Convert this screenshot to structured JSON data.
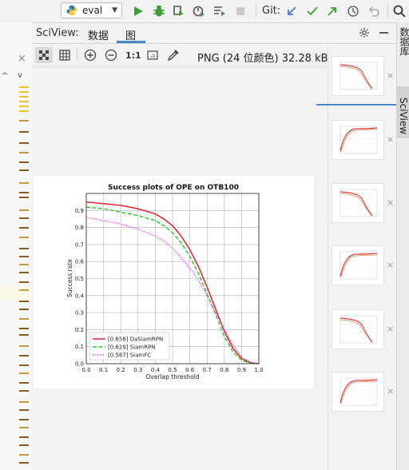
{
  "toolbar": {
    "run_config": "eval",
    "git_label": "Git:"
  },
  "sciview": {
    "title": "SciView:",
    "tabs": [
      "数据",
      "图"
    ],
    "image_info": "PNG (24 位颜色) 32.28 kB",
    "zoom_label": "1:1"
  },
  "right_panel": {
    "tabs": [
      "数据库",
      "SciView"
    ]
  },
  "chart_data": {
    "type": "line",
    "title": "Success plots of OPE on OTB100",
    "xlabel": "Overlap threshold",
    "ylabel": "Success rate",
    "xlim": [
      0,
      1
    ],
    "ylim": [
      0,
      1
    ],
    "x_ticks": [
      "0.0",
      "0.1",
      "0.2",
      "0.3",
      "0.4",
      "0.5",
      "0.6",
      "0.7",
      "0.8",
      "0.9",
      "1.0"
    ],
    "y_ticks": [
      "0.0",
      "0.1",
      "0.2",
      "0.3",
      "0.4",
      "0.5",
      "0.6",
      "0.7",
      "0.8",
      "0.9"
    ],
    "grid": true,
    "legend_position": "bottom-left",
    "x": [
      0.0,
      0.1,
      0.2,
      0.3,
      0.4,
      0.45,
      0.5,
      0.55,
      0.6,
      0.65,
      0.7,
      0.75,
      0.8,
      0.85,
      0.9,
      0.95,
      1.0
    ],
    "series": [
      {
        "name": "[0.658] DaSiamRPN",
        "color": "#e8141b",
        "style": "solid",
        "values": [
          0.95,
          0.94,
          0.93,
          0.91,
          0.88,
          0.85,
          0.81,
          0.75,
          0.67,
          0.57,
          0.45,
          0.32,
          0.19,
          0.09,
          0.03,
          0.005,
          0.0
        ]
      },
      {
        "name": "[0.629] SiamRPN",
        "color": "#1ecf1e",
        "style": "dashed",
        "values": [
          0.92,
          0.91,
          0.89,
          0.87,
          0.84,
          0.81,
          0.77,
          0.71,
          0.63,
          0.53,
          0.41,
          0.29,
          0.16,
          0.07,
          0.02,
          0.003,
          0.0
        ]
      },
      {
        "name": "[0.587] SiamFC",
        "color": "#ff22ff",
        "style": "dotted",
        "values": [
          0.86,
          0.84,
          0.82,
          0.79,
          0.75,
          0.72,
          0.68,
          0.62,
          0.56,
          0.49,
          0.4,
          0.3,
          0.2,
          0.11,
          0.04,
          0.01,
          0.0
        ]
      }
    ]
  }
}
